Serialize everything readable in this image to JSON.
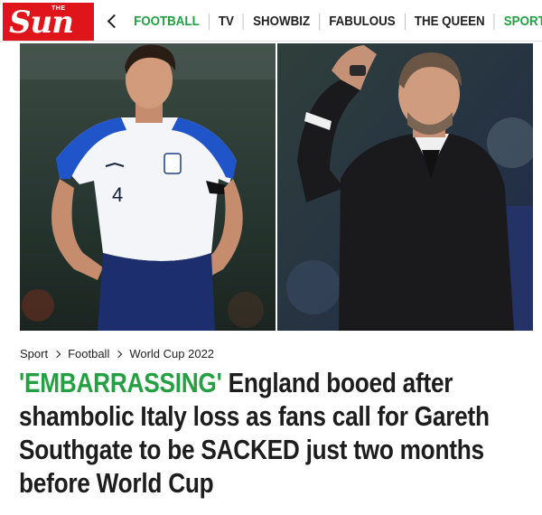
{
  "header": {
    "logo_small": "THE",
    "logo_main": "Sun",
    "nav": [
      {
        "label": "FOOTBALL",
        "color": "#24a043"
      },
      {
        "label": "TV"
      },
      {
        "label": "SHOWBIZ"
      },
      {
        "label": "FABULOUS"
      },
      {
        "label": "THE QUEEN"
      },
      {
        "label": "SPORT",
        "color": "#24a043"
      }
    ],
    "brand_color": "#e0151b",
    "accent_color": "#24a043"
  },
  "breadcrumb": [
    "Sport",
    "Football",
    "World Cup 2022"
  ],
  "article": {
    "kicker": "'EMBARRASSING'",
    "headline_lines": [
      " England booed after",
      "shambolic Italy loss as fans call for Gareth",
      "Southgate to be SACKED just two months",
      "before World Cup"
    ]
  },
  "hero": {
    "left_shirt_number": "4"
  }
}
